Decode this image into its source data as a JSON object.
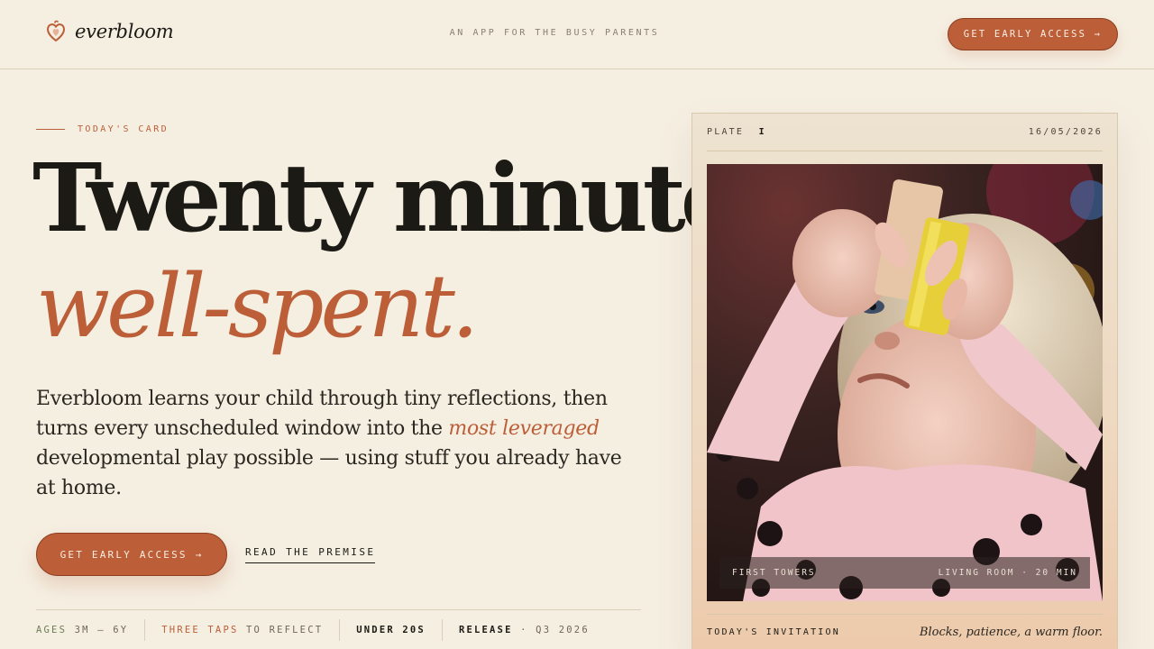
{
  "header": {
    "brand": "everbloom",
    "tagline": "AN APP FOR THE BUSY PARENTS",
    "cta_label": "GET EARLY ACCESS →"
  },
  "hero": {
    "eyebrow": "TODAY'S CARD",
    "headline_line1": "Twenty minutes,",
    "headline_line2": "well-spent.",
    "lede_part1": "Everbloom learns your child through tiny reflections, then turns every unscheduled window into the ",
    "lede_emphasis": "most leveraged",
    "lede_part2": " developmental play possible — using stuff you already have at home.",
    "cta_label": "GET EARLY ACCESS →",
    "secondary_link": "READ THE PREMISE"
  },
  "stats": [
    {
      "key": "AGES",
      "value": "3M – 6Y"
    },
    {
      "key": "THREE TAPS",
      "value": "TO REFLECT"
    },
    {
      "key": "UNDER 20S",
      "value": ""
    },
    {
      "key": "RELEASE",
      "value": "· Q3 2026"
    }
  ],
  "card": {
    "plate_label": "PLATE",
    "plate_number": "I",
    "date": "16/05/2026",
    "photo_caption_left": "FIRST TOWERS",
    "photo_caption_right": "LIVING ROOM · 20 MIN",
    "invitation_label": "TODAY'S INVITATION",
    "invitation_text": "Blocks, patience, a warm floor."
  },
  "colors": {
    "accent": "#bc5e38",
    "background": "#f5efe2",
    "ink": "#1c1a15"
  },
  "icons": {
    "logo": "heart-bloom-icon"
  }
}
